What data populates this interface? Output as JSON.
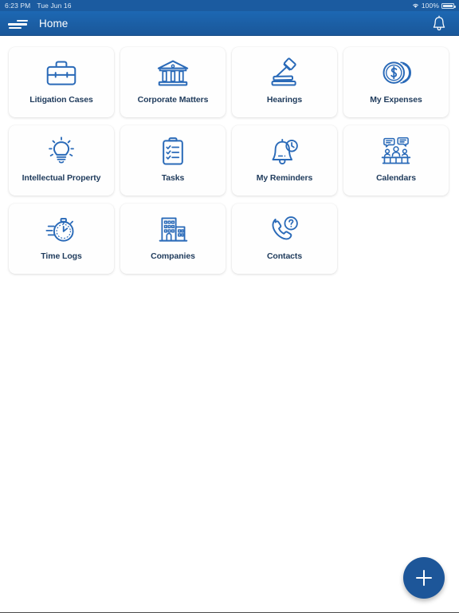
{
  "status_bar": {
    "time": "6:23 PM",
    "date": "Tue Jun 16",
    "battery_percent": "100%",
    "wifi_icon": "wifi-icon",
    "battery_icon": "battery-icon"
  },
  "nav": {
    "menu_icon": "hamburger-menu-icon",
    "title": "Home",
    "notification_icon": "bell-icon"
  },
  "colors": {
    "navbar": "#1b5ea4",
    "accent": "#2a6ab8",
    "label": "#1f3b5c",
    "fab": "#1d5699",
    "page_bg": "#ffffff",
    "tile_bg": "#fefefe"
  },
  "grid": {
    "tiles": [
      {
        "label": "Litigation Cases",
        "icon": "briefcase-icon"
      },
      {
        "label": "Corporate Matters",
        "icon": "courthouse-icon"
      },
      {
        "label": "Hearings",
        "icon": "gavel-icon"
      },
      {
        "label": "My Expenses",
        "icon": "coins-dollar-icon"
      },
      {
        "label": "Intellectual Property",
        "icon": "lightbulb-icon"
      },
      {
        "label": "Tasks",
        "icon": "clipboard-check-icon"
      },
      {
        "label": "My Reminders",
        "icon": "bell-clock-icon"
      },
      {
        "label": "Calendars",
        "icon": "meeting-people-icon"
      },
      {
        "label": "Time Logs",
        "icon": "stopwatch-icon"
      },
      {
        "label": "Companies",
        "icon": "office-buildings-icon"
      },
      {
        "label": "Contacts",
        "icon": "phone-question-icon"
      }
    ]
  },
  "fab": {
    "icon": "plus-icon",
    "label": "+"
  }
}
